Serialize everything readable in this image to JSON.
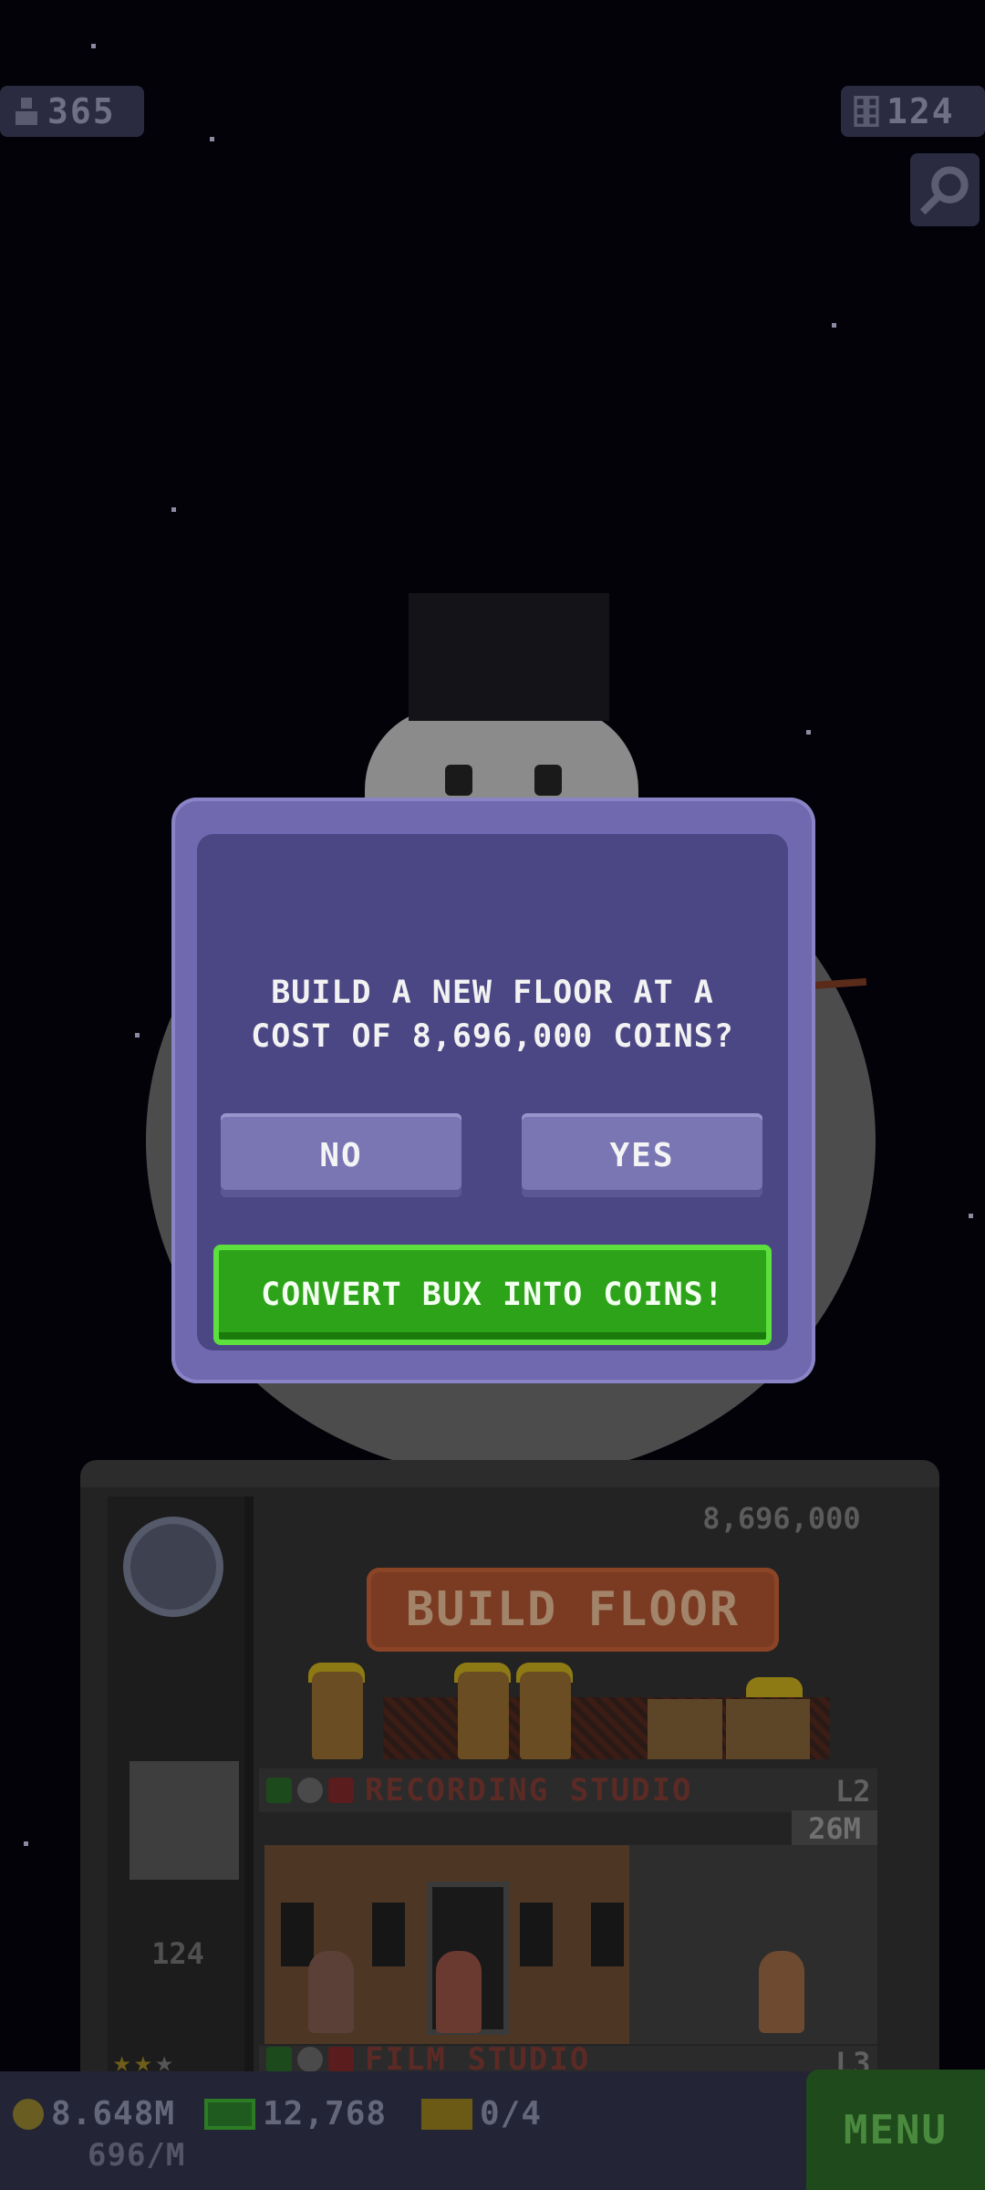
{
  "hud": {
    "population": "365",
    "population_icon": "person-icon",
    "floors": "124",
    "floors_icon": "building-icon",
    "search_icon": "magnifier-icon"
  },
  "dialog": {
    "message_line1": "BUILD A NEW FLOOR AT A",
    "message_line2": "COST OF 8,696,000 COINS?",
    "no_label": "NO",
    "yes_label": "YES",
    "convert_label": "CONVERT BUX INTO COINS!"
  },
  "building": {
    "next_floor_cost": "8,696,000",
    "build_sign": "BUILD FLOOR",
    "elevator_floor": "124",
    "floors": [
      {
        "name": "RECORDING STUDIO",
        "level": "L2",
        "cost": "26M"
      },
      {
        "name": "FILM STUDIO",
        "level": "L3"
      }
    ]
  },
  "footer": {
    "coins": "8.648M",
    "coin_rate": "696/M",
    "bux": "12,768",
    "tickets": "0/4",
    "menu_label": "MENU"
  },
  "colors": {
    "dialog_bg": "#4b4684",
    "dialog_frame": "#7069b0",
    "button_bg": "#7a76b4",
    "convert_green": "#2da31a",
    "footer_bg": "#232536"
  }
}
